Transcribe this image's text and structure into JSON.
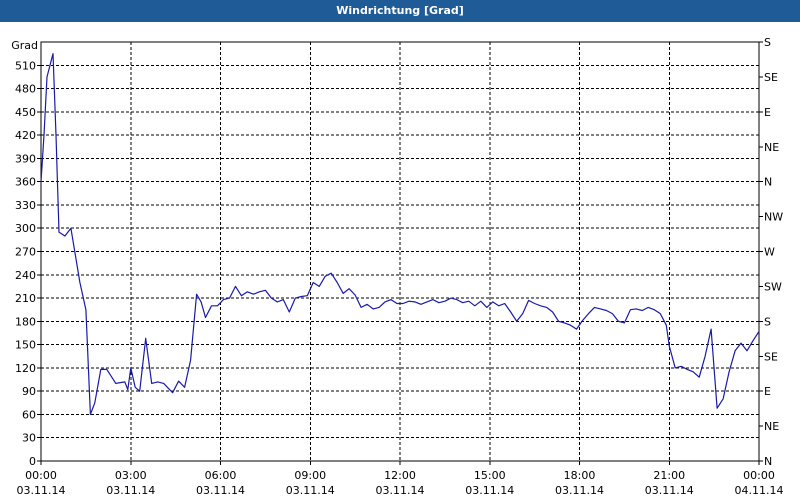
{
  "window": {
    "title": "Windrichtung [Grad]"
  },
  "chart_data": {
    "type": "line",
    "title": "Windrichtung [Grad]",
    "ylabel": "Grad",
    "ylim": [
      0,
      540
    ],
    "yticks": [
      0,
      30,
      60,
      90,
      120,
      150,
      180,
      210,
      240,
      270,
      300,
      330,
      360,
      390,
      420,
      450,
      480,
      510
    ],
    "y2ticks": [
      {
        "value": 0,
        "label": "N"
      },
      {
        "value": 45,
        "label": "NE"
      },
      {
        "value": 90,
        "label": "E"
      },
      {
        "value": 135,
        "label": "SE"
      },
      {
        "value": 180,
        "label": "S"
      },
      {
        "value": 225,
        "label": "SW"
      },
      {
        "value": 270,
        "label": "W"
      },
      {
        "value": 315,
        "label": "NW"
      },
      {
        "value": 360,
        "label": "N"
      },
      {
        "value": 405,
        "label": "NE"
      },
      {
        "value": 450,
        "label": "E"
      },
      {
        "value": 495,
        "label": "SE"
      },
      {
        "value": 540,
        "label": "S"
      }
    ],
    "xlim": [
      0,
      24
    ],
    "xticks": [
      {
        "hour": 0,
        "time": "00:00",
        "date": "03.11.14"
      },
      {
        "hour": 3,
        "time": "03:00",
        "date": "03.11.14"
      },
      {
        "hour": 6,
        "time": "06:00",
        "date": "03.11.14"
      },
      {
        "hour": 9,
        "time": "09:00",
        "date": "03.11.14"
      },
      {
        "hour": 12,
        "time": "12:00",
        "date": "03.11.14"
      },
      {
        "hour": 15,
        "time": "15:00",
        "date": "03.11.14"
      },
      {
        "hour": 18,
        "time": "18:00",
        "date": "03.11.14"
      },
      {
        "hour": 21,
        "time": "21:00",
        "date": "03.11.14"
      },
      {
        "hour": 24,
        "time": "00:00",
        "date": "04.11.14"
      }
    ],
    "grid": true,
    "line_color": "#1a1aa8",
    "series": [
      {
        "x": [
          0,
          0.1,
          0.2,
          0.3,
          0.4,
          0.5,
          0.6,
          0.8,
          1.0,
          1.3,
          1.5,
          1.65,
          1.8,
          2.0,
          2.2,
          2.5,
          2.8,
          2.9,
          3.0,
          3.15,
          3.3,
          3.5,
          3.7,
          3.9,
          4.1,
          4.4,
          4.6,
          4.8,
          5.0,
          5.2,
          5.35,
          5.5,
          5.7,
          5.9,
          6.1,
          6.3,
          6.5,
          6.7,
          6.9,
          7.1,
          7.3,
          7.5,
          7.7,
          7.9,
          8.1,
          8.3,
          8.5,
          8.7,
          8.9,
          9.1,
          9.3,
          9.5,
          9.7,
          9.9,
          10.1,
          10.3,
          10.5,
          10.7,
          10.9,
          11.1,
          11.3,
          11.5,
          11.7,
          11.9,
          12.1,
          12.3,
          12.5,
          12.7,
          12.9,
          13.1,
          13.3,
          13.5,
          13.7,
          13.9,
          14.1,
          14.3,
          14.5,
          14.7,
          14.9,
          15.1,
          15.3,
          15.5,
          15.7,
          15.9,
          16.1,
          16.3,
          16.5,
          16.7,
          16.9,
          17.1,
          17.3,
          17.5,
          17.7,
          17.9,
          18.1,
          18.3,
          18.5,
          18.7,
          18.9,
          19.1,
          19.3,
          19.5,
          19.7,
          19.9,
          20.1,
          20.3,
          20.5,
          20.7,
          20.9,
          21.0,
          21.2,
          21.4,
          21.6,
          21.8,
          22.0,
          22.2,
          22.4,
          22.6,
          22.8,
          23.0,
          23.2,
          23.4,
          23.6,
          23.8,
          24.0
        ],
        "y": [
          360,
          420,
          495,
          510,
          525,
          420,
          295,
          290,
          300,
          230,
          195,
          60,
          75,
          118,
          118,
          100,
          102,
          92,
          120,
          95,
          90,
          158,
          100,
          102,
          100,
          88,
          103,
          95,
          130,
          215,
          205,
          185,
          200,
          200,
          208,
          210,
          225,
          213,
          218,
          215,
          218,
          220,
          210,
          205,
          208,
          192,
          210,
          212,
          213,
          230,
          225,
          238,
          242,
          230,
          216,
          222,
          214,
          198,
          202,
          196,
          198,
          205,
          208,
          203,
          203,
          206,
          205,
          202,
          205,
          208,
          204,
          206,
          210,
          208,
          204,
          206,
          200,
          206,
          198,
          205,
          200,
          203,
          192,
          180,
          190,
          207,
          203,
          200,
          198,
          192,
          180,
          178,
          175,
          170,
          181,
          190,
          198,
          196,
          194,
          190,
          180,
          178,
          195,
          196,
          194,
          198,
          195,
          190,
          175,
          148,
          120,
          122,
          118,
          115,
          108,
          135,
          170,
          68,
          80,
          115,
          142,
          152,
          142,
          155,
          167
        ]
      }
    ]
  }
}
